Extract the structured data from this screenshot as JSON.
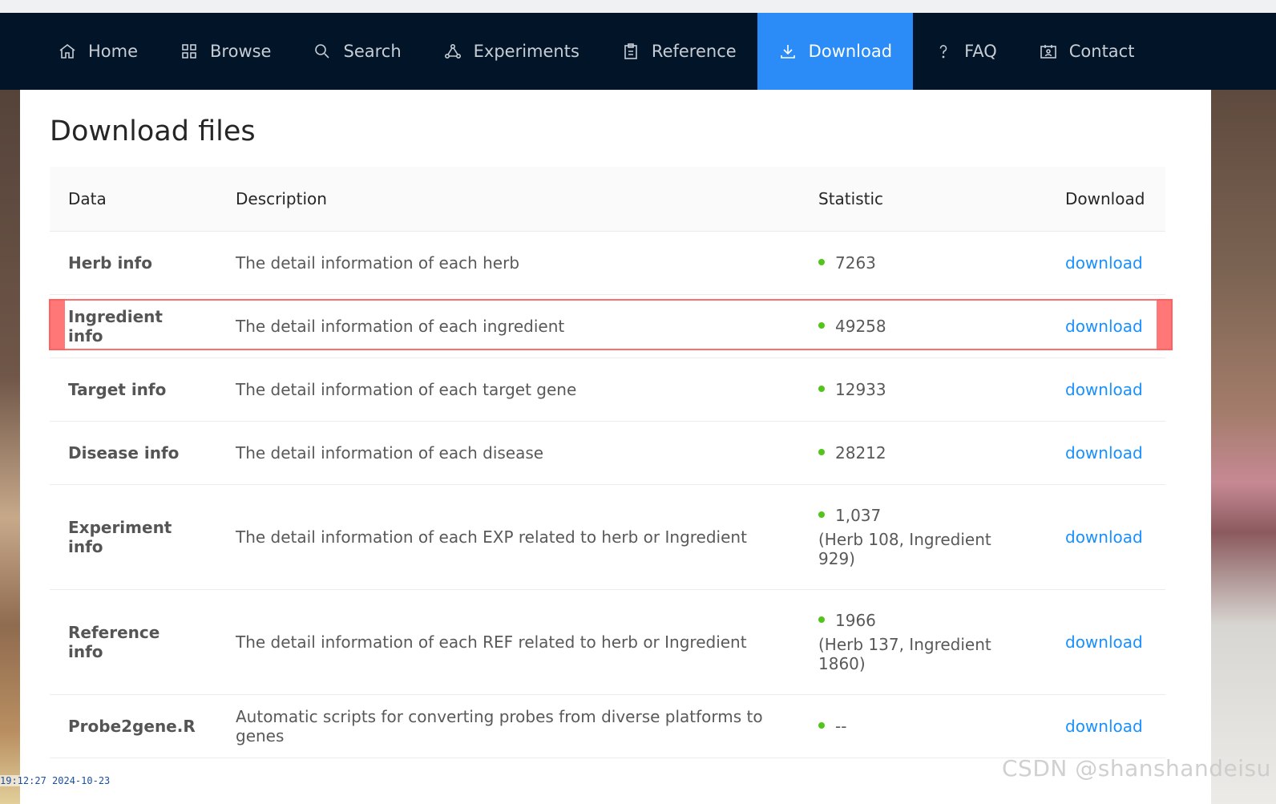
{
  "nav": {
    "items": [
      {
        "label": "Home",
        "icon": "home-icon"
      },
      {
        "label": "Browse",
        "icon": "grid-icon"
      },
      {
        "label": "Search",
        "icon": "search-icon"
      },
      {
        "label": "Experiments",
        "icon": "experiments-icon"
      },
      {
        "label": "Reference",
        "icon": "clipboard-icon"
      },
      {
        "label": "Download",
        "icon": "download-icon"
      },
      {
        "label": "FAQ",
        "icon": "question-icon"
      },
      {
        "label": "Contact",
        "icon": "contact-card-icon"
      }
    ],
    "active": "Download",
    "active_color": "#2c8cf7",
    "bar_color": "#011428"
  },
  "page": {
    "title": "Download files"
  },
  "table": {
    "headers": [
      "Data",
      "Description",
      "Statistic",
      "Download"
    ],
    "rows": [
      {
        "data": "Herb info",
        "description": "The detail information of each herb",
        "statistic": "7263",
        "detail": "",
        "download": "download"
      },
      {
        "data": "Ingredient info",
        "description": "The detail information of each ingredient",
        "statistic": "49258",
        "detail": "",
        "download": "download"
      },
      {
        "data": "Target info",
        "description": "The detail information of each target gene",
        "statistic": "12933",
        "detail": "",
        "download": "download"
      },
      {
        "data": "Disease info",
        "description": "The detail information of each disease",
        "statistic": "28212",
        "detail": "",
        "download": "download"
      },
      {
        "data": "Experiment info",
        "description": "The detail information of each EXP related to herb or Ingredient",
        "statistic": "1,037",
        "detail": "(Herb 108, Ingredient 929)",
        "download": "download"
      },
      {
        "data": "Reference info",
        "description": "The detail information of each REF related to herb or Ingredient",
        "statistic": "1966",
        "detail": "(Herb 137, Ingredient 1860)",
        "download": "download"
      },
      {
        "data": "Probe2gene.R",
        "description": "Automatic scripts for converting probes from diverse platforms to genes",
        "statistic": "--",
        "detail": "",
        "download": "download"
      }
    ],
    "highlighted_row": "Ingredient info",
    "status_dot_color": "#52c41a",
    "link_color": "#1890ff"
  },
  "overlay": {
    "timestamp": "19:12:27 2024-10-23",
    "watermark": "CSDN @shanshandeisu"
  }
}
